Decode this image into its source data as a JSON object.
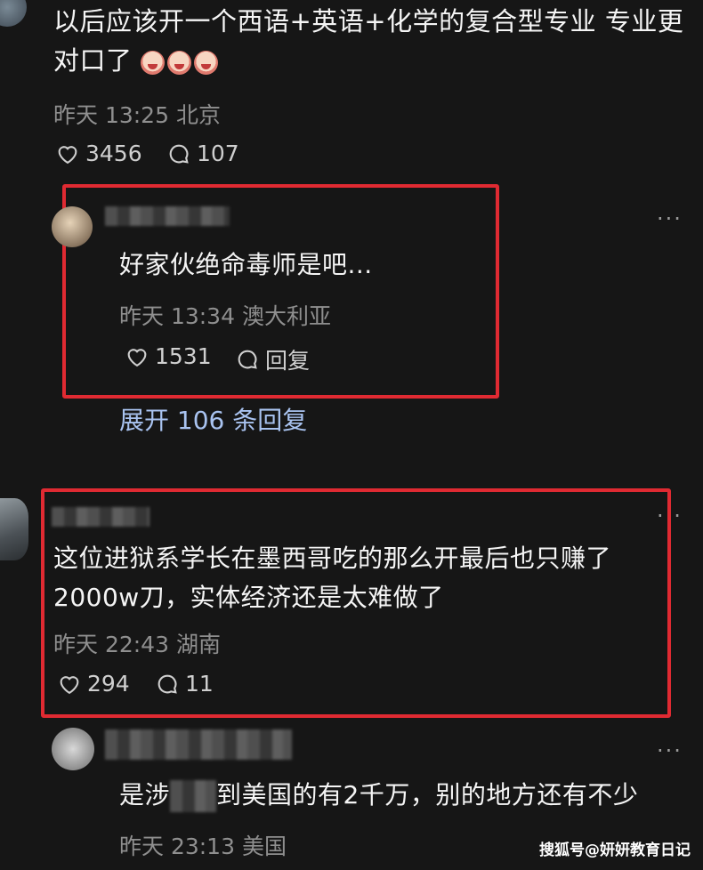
{
  "comments": [
    {
      "text_line1": "以后应该开一个西语+英语+化学的复合型专业 专业更",
      "text_line2": "对口了",
      "emoji": "crying-face-emoji",
      "emoji_count": 3,
      "meta": "昨天 13:25 北京",
      "likes": "3456",
      "replies": "107"
    },
    {
      "text": "好家伙绝命毒师是吧...",
      "meta": "昨天 13:34 澳大利亚",
      "likes": "1531",
      "replies": "回复",
      "more": "···"
    },
    {
      "expand": "展开 106 条回复"
    },
    {
      "text_line1": "这位进狱系学长在墨西哥吃的那么开最后也只赚了",
      "text_line2": "2000w刀，实体经济还是太难做了",
      "meta": "昨天 22:43 湖南",
      "likes": "294",
      "replies": "11",
      "more": "···"
    },
    {
      "text_a": "是涉",
      "text_b": "到美国的有2千万，别的地方还有不少",
      "meta": "昨天 23:13 美国",
      "more": "···"
    }
  ],
  "watermark": "搜狐号@妍妍教育日记",
  "colors": {
    "background": "#161616",
    "highlight_box": "#e02a32",
    "link": "#a9c3f0"
  }
}
